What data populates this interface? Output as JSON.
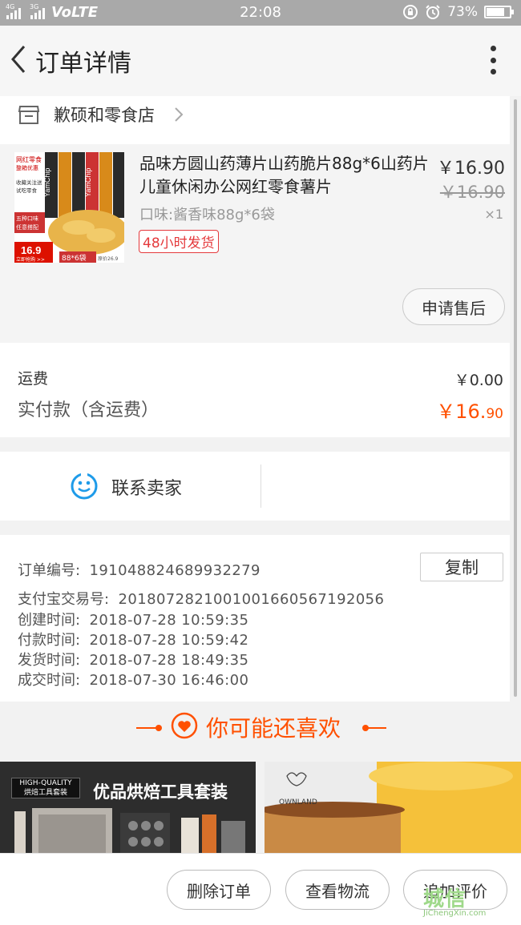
{
  "status_bar": {
    "network_1": "4G",
    "network_2": "3G",
    "volte": "VoLTE",
    "time": "22:08",
    "battery": "73%"
  },
  "header": {
    "title": "订单详情"
  },
  "shop": {
    "name": "歉硕和零食店"
  },
  "product": {
    "name": "品味方圆山药薄片山药脆片88g*6山药片儿童休闲办公网红零食薯片",
    "price": "￥16.90",
    "original_price": "￥16.90",
    "sku": "口味:酱香味88g*6袋",
    "quantity": "×1",
    "tag": "48小时发货",
    "after_sale_button": "申请售后",
    "thumb": {
      "t1": "网红零食",
      "t2": "整箱优惠",
      "t3": "收藏关注送",
      "t4": "试吃零食",
      "t5": "五种口味",
      "t6": "任意搭配",
      "price": "16.9",
      "buy": "立即抢购 >>",
      "pack": "88*6袋",
      "orig": "原价26.9",
      "brand": "YamChip"
    }
  },
  "fees": {
    "shipping_label": "运费",
    "shipping_value": "￥0.00",
    "paid_label": "实付款（含运费）",
    "paid_value_main": "￥16.",
    "paid_value_cents": "90"
  },
  "contact": {
    "label": "联系卖家"
  },
  "order_info": {
    "copy_button": "复制",
    "rows": [
      {
        "key": "订单编号:",
        "value": "191048824689932279"
      },
      {
        "key": "支付宝交易号:",
        "value": "2018072821001001660567192056"
      },
      {
        "key": "创建时间:",
        "value": "2018-07-28 10:59:35"
      },
      {
        "key": "付款时间:",
        "value": "2018-07-28 10:59:42"
      },
      {
        "key": "发货时间:",
        "value": "2018-07-28 18:49:35"
      },
      {
        "key": "成交时间:",
        "value": "2018-07-30 16:46:00"
      }
    ]
  },
  "recommend": {
    "title": "你可能还喜欢",
    "item1_badge_1": "HIGH-QUALITY",
    "item1_badge_2": "烘焙工具套装",
    "item1_title": "优品烘焙工具套装",
    "item2_brand": "OWNLAND"
  },
  "bottom_bar": {
    "delete": "删除订单",
    "logistics": "查看物流",
    "review": "追加评价"
  },
  "watermark": {
    "top": "城信",
    "bottom": "JiChengXin.com"
  },
  "colors": {
    "accent": "#ff5000",
    "tag_red": "#e4393c",
    "status_bar": "#a9a9a9",
    "contact_icon": "#1e9be9"
  }
}
